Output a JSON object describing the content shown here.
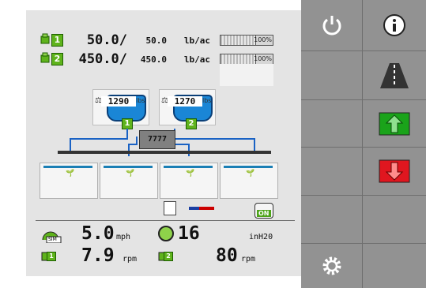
{
  "products": [
    {
      "num": "1",
      "rate": "50.0/",
      "target": "50.0",
      "unit": "lb/ac",
      "pct": "100%"
    },
    {
      "num": "2",
      "rate": "450.0/",
      "target": "450.0",
      "unit": "lb/ac",
      "pct": "100%"
    }
  ],
  "tanks": [
    {
      "num": "1",
      "value": "1290",
      "unit": "lbs"
    },
    {
      "num": "2",
      "value": "1270",
      "unit": "lbs"
    }
  ],
  "meter": {
    "label": "7777"
  },
  "status": {
    "on_label": "ON"
  },
  "gauges": {
    "sim_label": "SIM",
    "speed_value": "5.0",
    "speed_unit": "mph",
    "pressure_value": "16",
    "pressure_unit": "inH20",
    "fan1_num": "1",
    "fan1_value": "7.9",
    "fan1_unit": "rpm",
    "fan2_num": "2",
    "fan2_value": "80",
    "fan2_unit": "rpm"
  },
  "colors": {
    "accent_green": "#5fb31c",
    "up_arrow": "#1aa31a",
    "down_arrow": "#e0161f",
    "product_blue": "#1a86d6"
  },
  "icons": [
    "power-icon",
    "info-icon",
    "road-icon",
    "increase-rate-icon",
    "decrease-rate-icon",
    "settings-gear-icon"
  ]
}
